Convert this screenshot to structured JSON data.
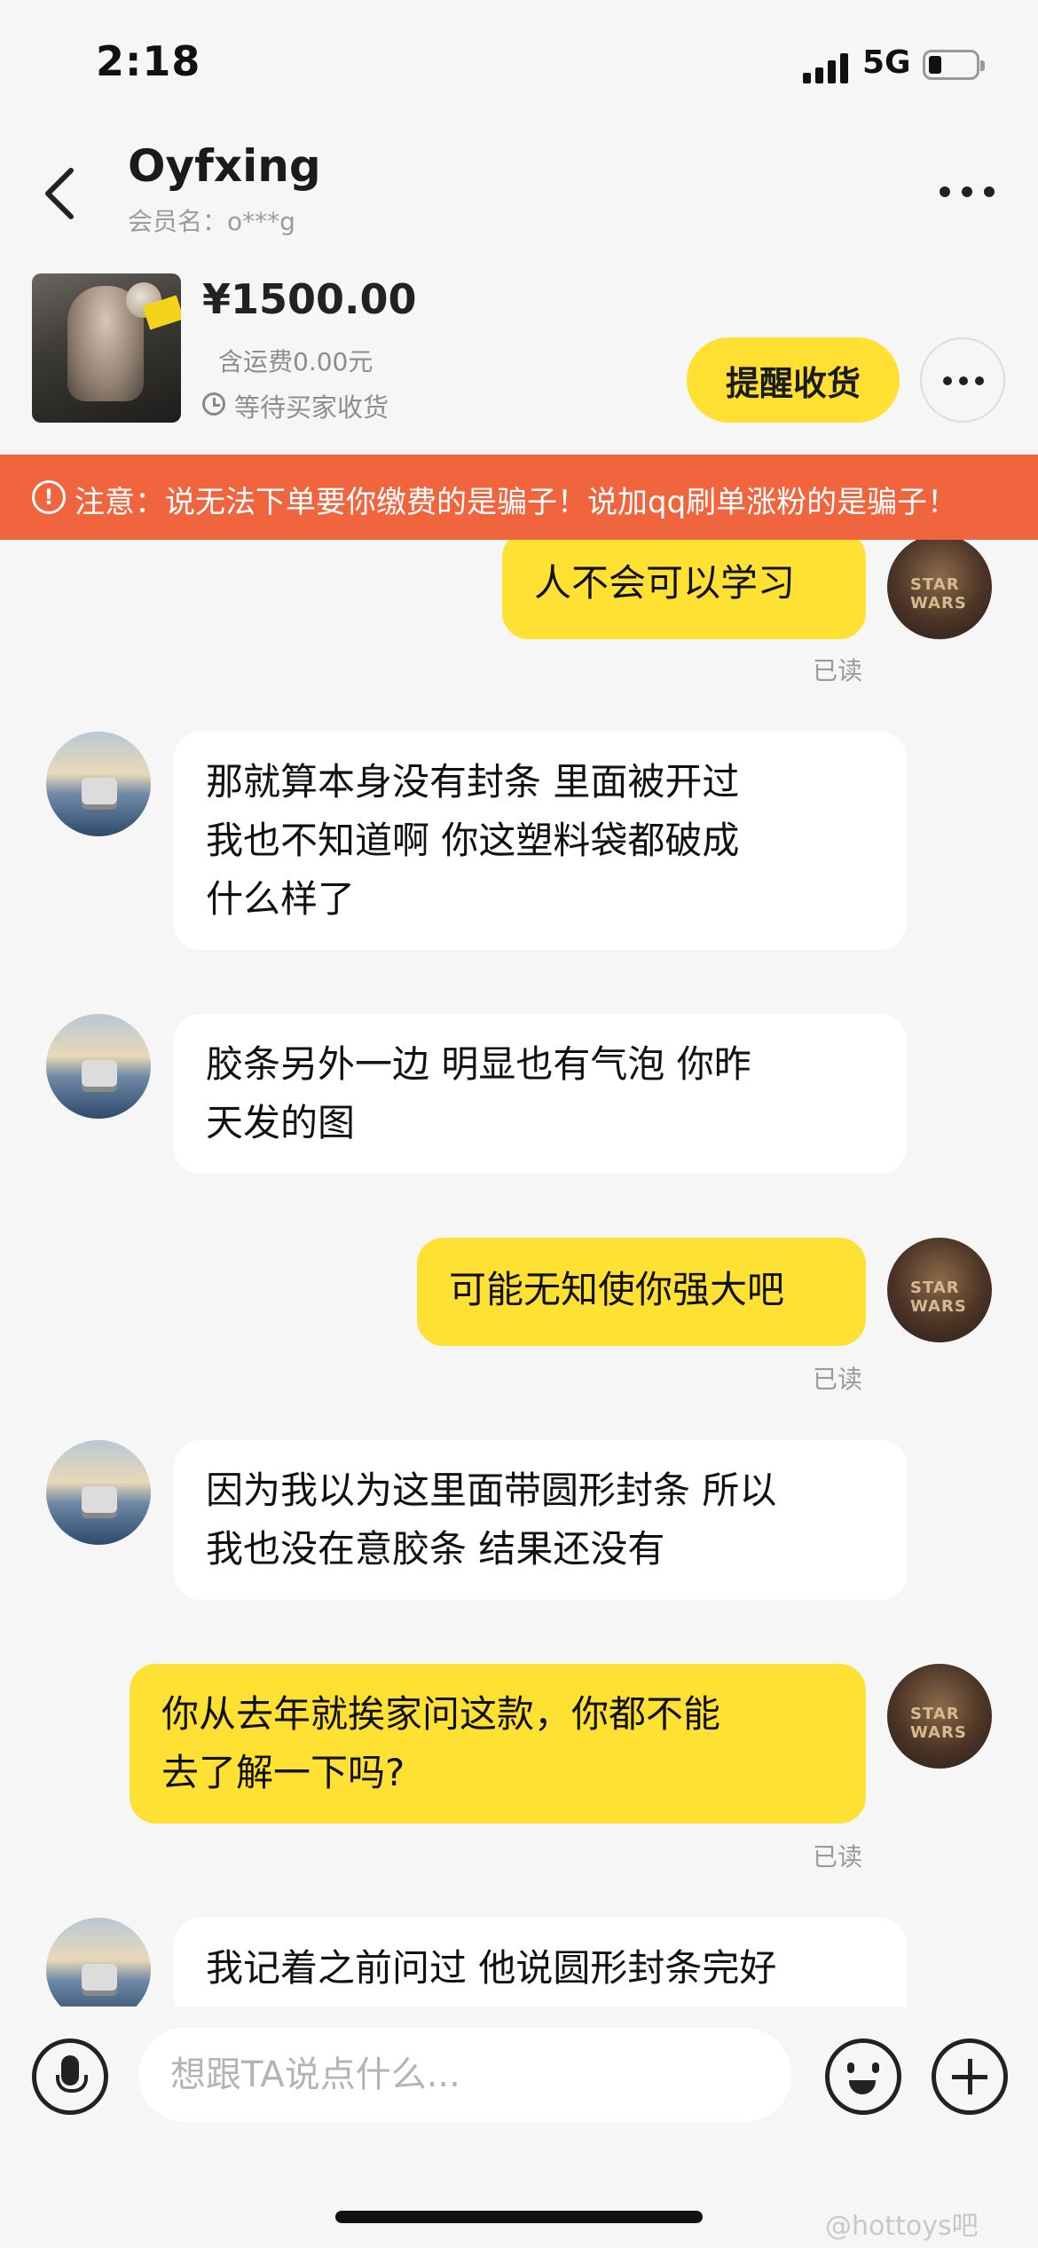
{
  "status_bar": {
    "time": "2:18",
    "network": "5G",
    "battery_icon": "battery-low-icon",
    "signal_icon": "cellular-signal-icon"
  },
  "header": {
    "title": "Oyfxing",
    "member_name": "会员名：o***g",
    "back_icon": "chevron-left-icon",
    "more_icon": "more-horizontal-icon"
  },
  "product": {
    "price": "¥1500.00",
    "shipping": "含运费0.00元",
    "status": "等待买家收货",
    "remind_label": "提醒收货"
  },
  "warning": {
    "icon": "!",
    "text": "注意：说无法下单要你缴费的是骗子！说加qq刷单涨粉的是骗子！"
  },
  "messages": [
    {
      "sender": "me",
      "lines": [
        "人不会可以学习"
      ],
      "read": "已读"
    },
    {
      "sender": "them",
      "lines": [
        "那就算本身没有封条  里面被开过",
        "我也不知道啊   你这塑料袋都破成",
        "什么样了"
      ]
    },
    {
      "sender": "them",
      "lines": [
        "胶条另外一边 明显也有气泡  你昨",
        "天发的图"
      ]
    },
    {
      "sender": "me",
      "lines": [
        "可能无知使你强大吧"
      ],
      "read": "已读"
    },
    {
      "sender": "them",
      "lines": [
        "因为我以为这里面带圆形封条  所以",
        "我也没在意胶条   结果还没有"
      ]
    },
    {
      "sender": "me",
      "lines": [
        "你从去年就挨家问这款，你都不能",
        "去了解一下吗?"
      ],
      "read": "已读"
    },
    {
      "sender": "them",
      "lines": [
        "我记着之前问过  他说圆形封条完好"
      ]
    }
  ],
  "my_avatar_text": "STAR WARS",
  "input": {
    "placeholder": "想跟TA说点什么...",
    "mic_icon": "microphone-icon",
    "emoji_icon": "emoji-icon",
    "plus_icon": "plus-icon"
  },
  "watermark": "@hottoys吧"
}
